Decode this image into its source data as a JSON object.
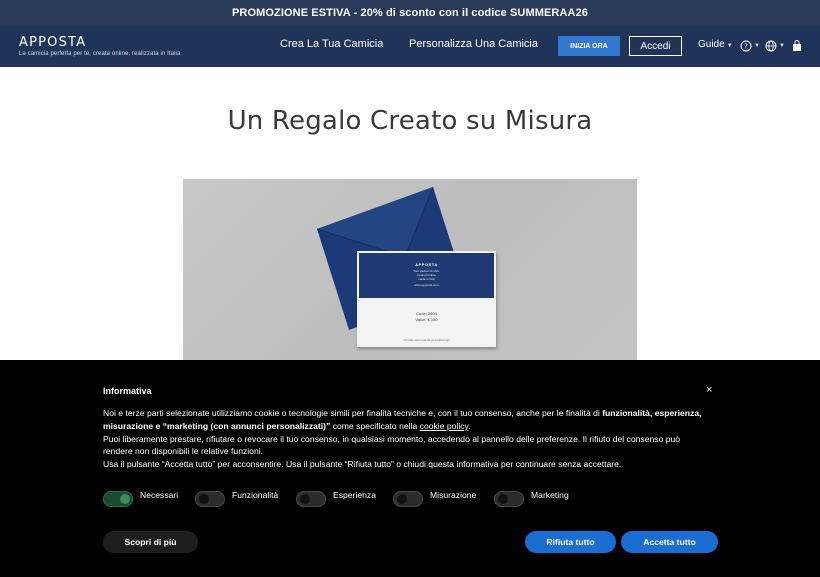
{
  "promo": {
    "text": "PROMOZIONE ESTIVA - 20% di sconto con il codice SUMMERAA26"
  },
  "navbar": {
    "brand": "APPOSTA",
    "tagline": "La camicia perfetta per te, creata online, realizzata in Italia",
    "links": [
      "Crea La Tua Camicia",
      "Personalizza Una Camicia"
    ],
    "start_label": "INIZIA ORA",
    "login_label": "Accedi",
    "guide_label": "Guide",
    "icons": [
      "help-icon",
      "globe-icon",
      "shopping-bag-icon"
    ]
  },
  "main": {
    "title": "Un Regalo Creato su Misura",
    "gift_card": {
      "brand": "APPOSTA",
      "text_lines": [
        "Your perfect fit shirt,",
        "created online,",
        "made in Italy"
      ],
      "url": "www.apposta.com",
      "code_line": "Code: 2904",
      "value_line": "Value: € 150",
      "footer": "Print this card to use the personalised gift",
      "colors": {
        "envelope": "#1f3a72",
        "card_header": "#1f3a72"
      }
    }
  },
  "cookie": {
    "title": "Informativa",
    "close_icon": "close-icon",
    "body": {
      "p1_a": "Noi e terze parti selezionate utilizziamo cookie o tecnologie simili per finalità tecniche e, con il tuo consenso, anche per le finalità di ",
      "p1_b": "funzionalità, esperienza, misurazione e “marketing (con annunci personalizzati)”",
      "p1_c": " come specificato nella ",
      "p1_link": "cookie policy",
      "p1_d": ".",
      "p2": "Puoi liberamente prestare, rifiutare o revocare il tuo consenso, in qualsiasi momento, accedendo al pannello delle preferenze. Il rifiuto del consenso può rendere non disponibili le relative funzioni.",
      "p3": "Usa il pulsante “Accetta tutto” per acconsentire. Usa il pulsante “Rifiuta tutto” o chiudi questa informativa per continuare senza accettare."
    },
    "toggles": [
      {
        "label": "Necessari",
        "on": true
      },
      {
        "label": "Funzionalità",
        "on": false
      },
      {
        "label": "Esperienza",
        "on": false
      },
      {
        "label": "Misurazione",
        "on": false
      },
      {
        "label": "Marketing",
        "on": false
      }
    ],
    "more_label": "Scopri di più",
    "reject_label": "Rifiuta tutto",
    "accept_label": "Accetta tutto",
    "colors": {
      "primary_button": "#1a6dd2",
      "toggle_on": "#3f8a5f"
    }
  }
}
